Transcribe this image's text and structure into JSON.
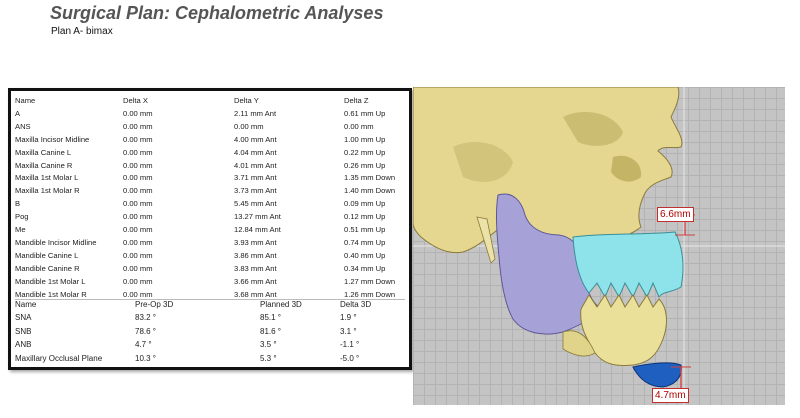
{
  "header": {
    "title": "Surgical Plan: Cephalometric Analyses",
    "subtitle": "Plan A- bimax"
  },
  "landmarks": {
    "columns": [
      "Name",
      "Delta X",
      "Delta Y",
      "Delta Z"
    ],
    "rows": [
      [
        "A",
        "0.00 mm",
        "2.11 mm Ant",
        "0.61 mm Up"
      ],
      [
        "ANS",
        "0.00 mm",
        "0.00 mm",
        "0.00 mm"
      ],
      [
        "Maxilla Incisor Midline",
        "0.00 mm",
        "4.00 mm Ant",
        "1.00 mm Up"
      ],
      [
        "Maxilla Canine L",
        "0.00 mm",
        "4.04 mm Ant",
        "0.22 mm Up"
      ],
      [
        "Maxilla Canine R",
        "0.00 mm",
        "4.01 mm Ant",
        "0.26 mm Up"
      ],
      [
        "Maxilla 1st Molar L",
        "0.00 mm",
        "3.71 mm Ant",
        "1.35 mm Down"
      ],
      [
        "Maxilla 1st Molar R",
        "0.00 mm",
        "3.73 mm Ant",
        "1.40 mm Down"
      ],
      [
        "B",
        "0.00 mm",
        "5.45 mm Ant",
        "0.09 mm Up"
      ],
      [
        "Pog",
        "0.00 mm",
        "13.27 mm Ant",
        "0.12 mm Up"
      ],
      [
        "Me",
        "0.00 mm",
        "12.84 mm Ant",
        "0.51 mm Up"
      ],
      [
        "Mandible Incisor Midline",
        "0.00 mm",
        "3.93 mm Ant",
        "0.74 mm Up"
      ],
      [
        "Mandible Canine L",
        "0.00 mm",
        "3.86 mm Ant",
        "0.40 mm Up"
      ],
      [
        "Mandible Canine R",
        "0.00 mm",
        "3.83 mm Ant",
        "0.34 mm Up"
      ],
      [
        "Mandible 1st Molar L",
        "0.00 mm",
        "3.66 mm Ant",
        "1.27 mm Down"
      ],
      [
        "Mandible 1st Molar R",
        "0.00 mm",
        "3.68 mm Ant",
        "1.26 mm Down"
      ]
    ]
  },
  "angles": {
    "columns": [
      "Name",
      "Pre-Op 3D",
      "Planned 3D",
      "Delta 3D"
    ],
    "rows": [
      [
        "SNA",
        "83.2 °",
        "85.1 °",
        "1.9 °"
      ],
      [
        "SNB",
        "78.6 °",
        "81.6 °",
        "3.1 °"
      ],
      [
        "ANB",
        "4.7 °",
        "3.5 °",
        "-1.1 °"
      ],
      [
        "Maxillary Occlusal Plane",
        "10.3 °",
        "5.3 °",
        "-5.0 °"
      ]
    ]
  },
  "viewer": {
    "measurement_upper": "6.6mm",
    "measurement_lower": "4.7mm",
    "colors": {
      "skull": "#e5d690",
      "mandible_ramus": "#a6a2d8",
      "maxilla": "#8ee3ea",
      "chin_segment": "#1f5fc0",
      "measure_line": "#d04040",
      "grid": "#c4c4c4"
    }
  }
}
